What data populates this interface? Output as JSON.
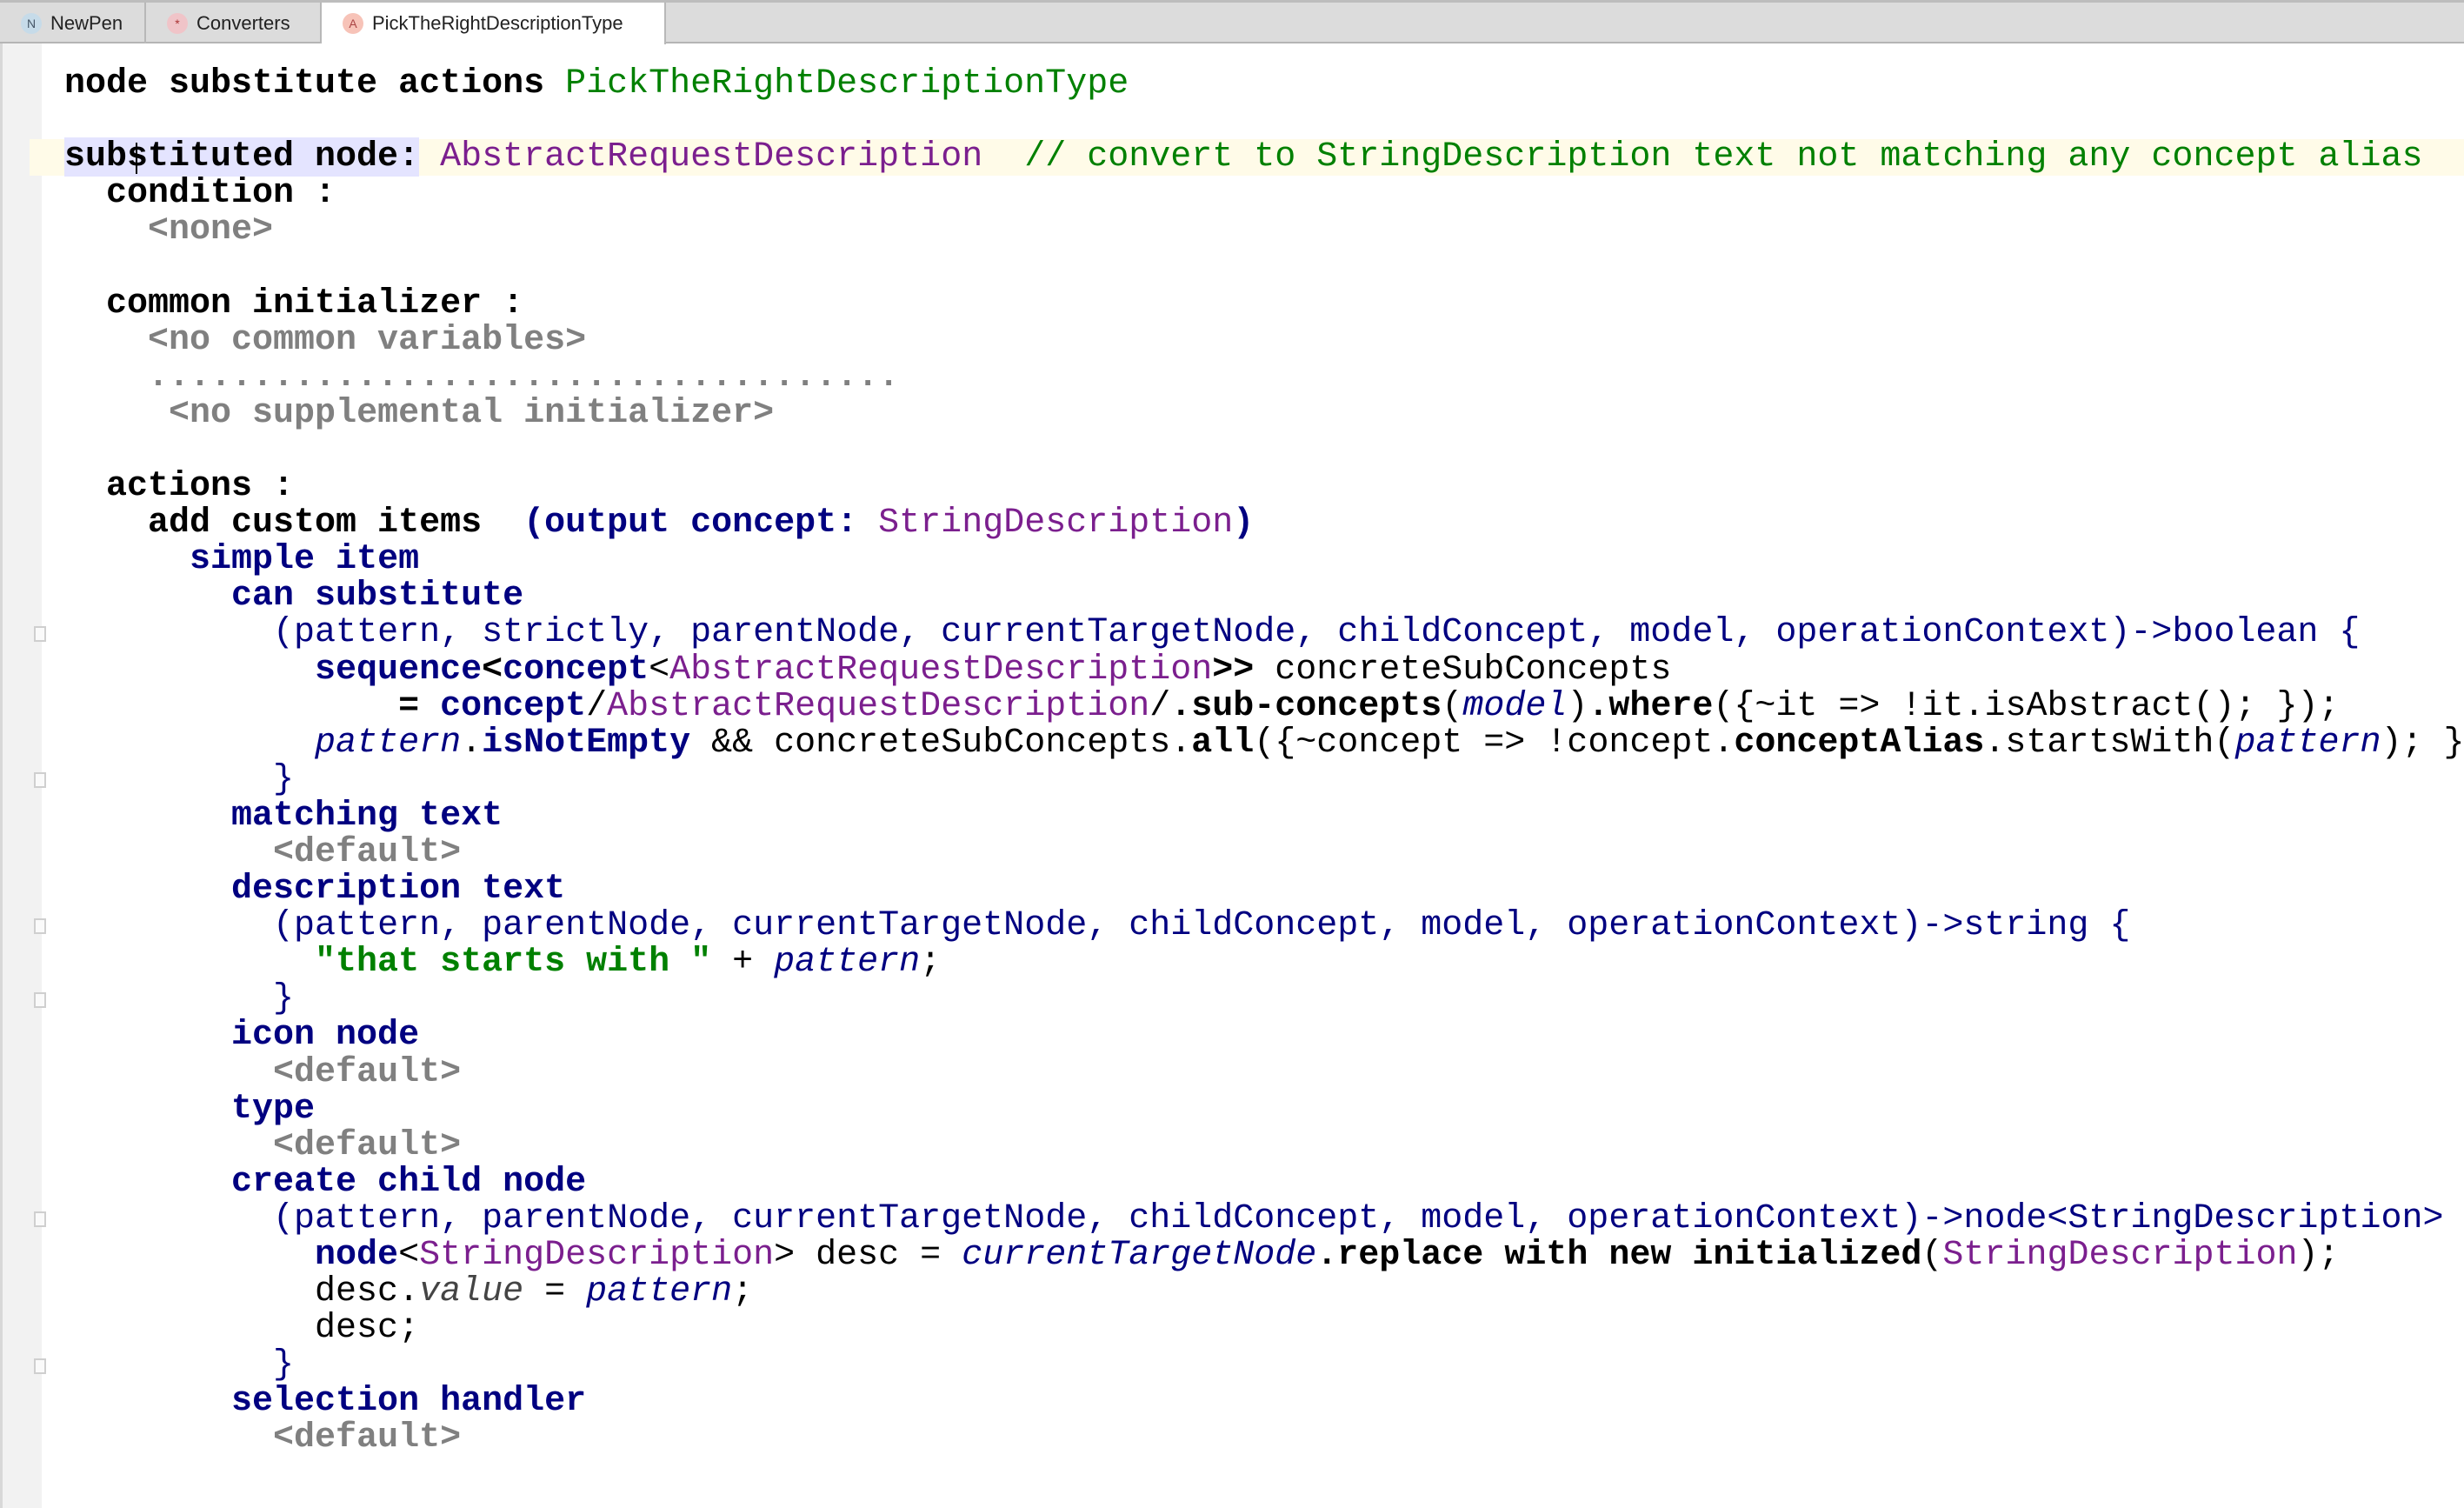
{
  "tabs": [
    {
      "label": "NewPen",
      "icon": "N",
      "icon_color": "#c6dbe9"
    },
    {
      "label": "Converters",
      "icon": "*",
      "icon_color": "#f0c4c8"
    },
    {
      "label": "PickTheRightDescriptionType",
      "icon": "A",
      "icon_color": "#f7c3b8",
      "active": true
    }
  ],
  "colors": {
    "keyword": "#000080",
    "concept": "#7b1f8e",
    "string": "#008000",
    "placeholder": "#808080"
  },
  "lines": [
    {
      "indent": 0,
      "tokens": [
        [
          "b",
          "node substitute actions "
        ],
        [
          "g",
          "PickTheRightDescriptionType"
        ]
      ]
    },
    {
      "indent": 0,
      "tokens": []
    },
    {
      "indent": 0,
      "current": true,
      "tokens": [
        [
          "b sel",
          "substituted node:"
        ],
        [
          "t",
          " "
        ],
        [
          "p",
          "AbstractRequestDescription"
        ],
        [
          "t",
          "  "
        ],
        [
          "g",
          "// convert to StringDescription text not matching any concept alias"
        ]
      ]
    },
    {
      "indent": 2,
      "tokens": [
        [
          "b",
          "condition :"
        ]
      ]
    },
    {
      "indent": 4,
      "tokens": [
        [
          "gr",
          "<none>"
        ]
      ]
    },
    {
      "indent": 0,
      "tokens": []
    },
    {
      "indent": 2,
      "tokens": [
        [
          "b",
          "common initializer :"
        ]
      ]
    },
    {
      "indent": 4,
      "tokens": [
        [
          "gr",
          "<no common variables>"
        ]
      ]
    },
    {
      "indent": 4,
      "tokens": [
        [
          "dots",
          "...................................."
        ]
      ]
    },
    {
      "indent": 5,
      "tokens": [
        [
          "gr",
          "<no supplemental initializer>"
        ]
      ]
    },
    {
      "indent": 0,
      "tokens": []
    },
    {
      "indent": 2,
      "tokens": [
        [
          "b",
          "actions :"
        ]
      ]
    },
    {
      "indent": 4,
      "tokens": [
        [
          "b",
          "add custom items  "
        ],
        [
          "k",
          "(output concept: "
        ],
        [
          "p",
          "StringDescription"
        ],
        [
          "k",
          ")"
        ]
      ]
    },
    {
      "indent": 6,
      "tokens": [
        [
          "k",
          "simple item"
        ]
      ]
    },
    {
      "indent": 8,
      "tokens": [
        [
          "k",
          "can substitute"
        ]
      ]
    },
    {
      "indent": 10,
      "fold": true,
      "tokens": [
        [
          "n",
          "(pattern, strictly, parentNode, currentTargetNode, childConcept, model, operationContext)->boolean {"
        ]
      ]
    },
    {
      "indent": 12,
      "tokens": [
        [
          "k",
          "sequence"
        ],
        [
          "b",
          "<"
        ],
        [
          "k",
          "concept"
        ],
        [
          "t",
          "<"
        ],
        [
          "p",
          "AbstractRequestDescription"
        ],
        [
          "b",
          ">>"
        ],
        [
          "t",
          " concreteSubConcepts"
        ]
      ]
    },
    {
      "indent": 16,
      "tokens": [
        [
          "b",
          "= "
        ],
        [
          "k",
          "concept"
        ],
        [
          "t",
          "/"
        ],
        [
          "p",
          "AbstractRequestDescription"
        ],
        [
          "t",
          "/"
        ],
        [
          "b",
          ".sub-concepts"
        ],
        [
          "t",
          "("
        ],
        [
          "i",
          "model"
        ],
        [
          "t",
          ")"
        ],
        [
          "b",
          ".where"
        ],
        [
          "t",
          "({~it => !it.isAbstract(); });"
        ]
      ]
    },
    {
      "indent": 12,
      "tokens": [
        [
          "i",
          "pattern"
        ],
        [
          "t",
          "."
        ],
        [
          "k",
          "isNotEmpty"
        ],
        [
          "t",
          " && concreteSubConcepts."
        ],
        [
          "b",
          "all"
        ],
        [
          "t",
          "({~concept => !concept."
        ],
        [
          "b",
          "conceptAlias"
        ],
        [
          "t",
          ".startsWith("
        ],
        [
          "i",
          "pattern"
        ],
        [
          "t",
          "); }"
        ]
      ]
    },
    {
      "indent": 10,
      "fold": true,
      "tokens": [
        [
          "n",
          "}"
        ]
      ]
    },
    {
      "indent": 8,
      "tokens": [
        [
          "k",
          "matching text"
        ]
      ]
    },
    {
      "indent": 10,
      "tokens": [
        [
          "gr",
          "<default>"
        ]
      ]
    },
    {
      "indent": 8,
      "tokens": [
        [
          "k",
          "description text"
        ]
      ]
    },
    {
      "indent": 10,
      "fold": true,
      "tokens": [
        [
          "n",
          "(pattern, parentNode, currentTargetNode, childConcept, model, operationContext)->string {"
        ]
      ]
    },
    {
      "indent": 12,
      "tokens": [
        [
          "gs",
          "\"that starts with \""
        ],
        [
          "t",
          " + "
        ],
        [
          "i",
          "pattern"
        ],
        [
          "t",
          ";"
        ]
      ]
    },
    {
      "indent": 10,
      "fold": true,
      "tokens": [
        [
          "n",
          "}"
        ]
      ]
    },
    {
      "indent": 8,
      "tokens": [
        [
          "k",
          "icon node"
        ]
      ]
    },
    {
      "indent": 10,
      "tokens": [
        [
          "gr",
          "<default>"
        ]
      ]
    },
    {
      "indent": 8,
      "tokens": [
        [
          "k",
          "type"
        ]
      ]
    },
    {
      "indent": 10,
      "tokens": [
        [
          "gr",
          "<default>"
        ]
      ]
    },
    {
      "indent": 8,
      "tokens": [
        [
          "k",
          "create child node"
        ]
      ]
    },
    {
      "indent": 10,
      "fold": true,
      "tokens": [
        [
          "n",
          "(pattern, parentNode, currentTargetNode, childConcept, model, operationContext)->node<StringDescription>"
        ]
      ]
    },
    {
      "indent": 12,
      "tokens": [
        [
          "k",
          "node"
        ],
        [
          "t",
          "<"
        ],
        [
          "p",
          "StringDescription"
        ],
        [
          "t",
          "> desc = "
        ],
        [
          "i",
          "currentTargetNode"
        ],
        [
          "b",
          ".replace with new initialized"
        ],
        [
          "t",
          "("
        ],
        [
          "p",
          "StringDescription"
        ],
        [
          "t",
          ");"
        ]
      ]
    },
    {
      "indent": 12,
      "tokens": [
        [
          "t",
          "desc."
        ],
        [
          "ig",
          "value"
        ],
        [
          "t",
          " = "
        ],
        [
          "i",
          "pattern"
        ],
        [
          "t",
          ";"
        ]
      ]
    },
    {
      "indent": 12,
      "tokens": [
        [
          "t",
          "desc;"
        ]
      ]
    },
    {
      "indent": 10,
      "fold": true,
      "tokens": [
        [
          "n",
          "}"
        ]
      ]
    },
    {
      "indent": 8,
      "tokens": [
        [
          "k",
          "selection handler"
        ]
      ]
    },
    {
      "indent": 10,
      "tokens": [
        [
          "gr",
          "<default>"
        ]
      ]
    }
  ]
}
